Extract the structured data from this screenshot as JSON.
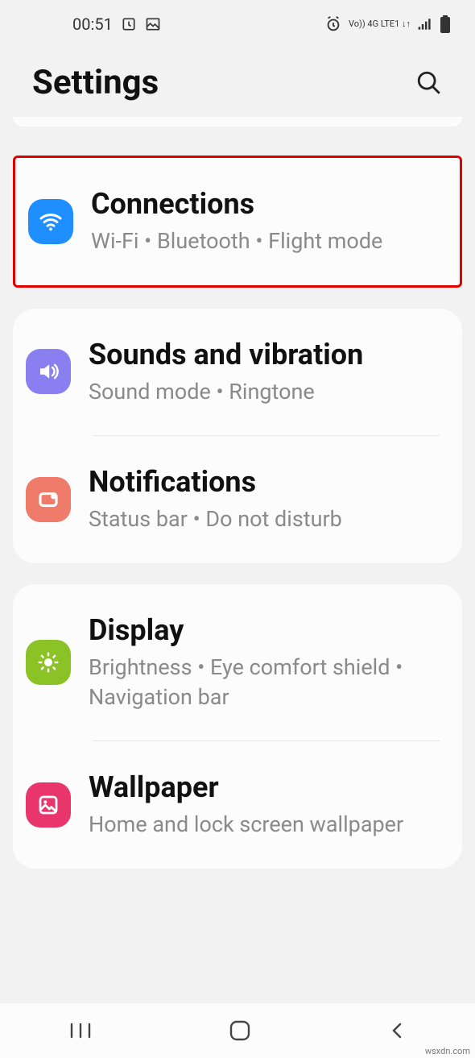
{
  "status": {
    "time": "00:51",
    "net": "Vo)) 4G LTE1 ↓↑"
  },
  "header": {
    "title": "Settings"
  },
  "groups": [
    {
      "highlight": true,
      "rows": [
        {
          "icon": "wifi-icon",
          "title": "Connections",
          "sub": "Wi-Fi  •  Bluetooth  •  Flight mode"
        }
      ]
    },
    {
      "highlight": false,
      "rows": [
        {
          "icon": "sound-icon",
          "title": "Sounds and vibration",
          "sub": "Sound mode  •  Ringtone"
        },
        {
          "icon": "notif-icon",
          "title": "Notifications",
          "sub": "Status bar  •  Do not disturb"
        }
      ]
    },
    {
      "highlight": false,
      "rows": [
        {
          "icon": "display-icon",
          "title": "Display",
          "sub": "Brightness  •  Eye comfort shield  •  Navigation bar"
        },
        {
          "icon": "wallpaper-icon",
          "title": "Wallpaper",
          "sub": "Home and lock screen wallpaper"
        }
      ]
    }
  ],
  "watermark": "wsxdn.com"
}
